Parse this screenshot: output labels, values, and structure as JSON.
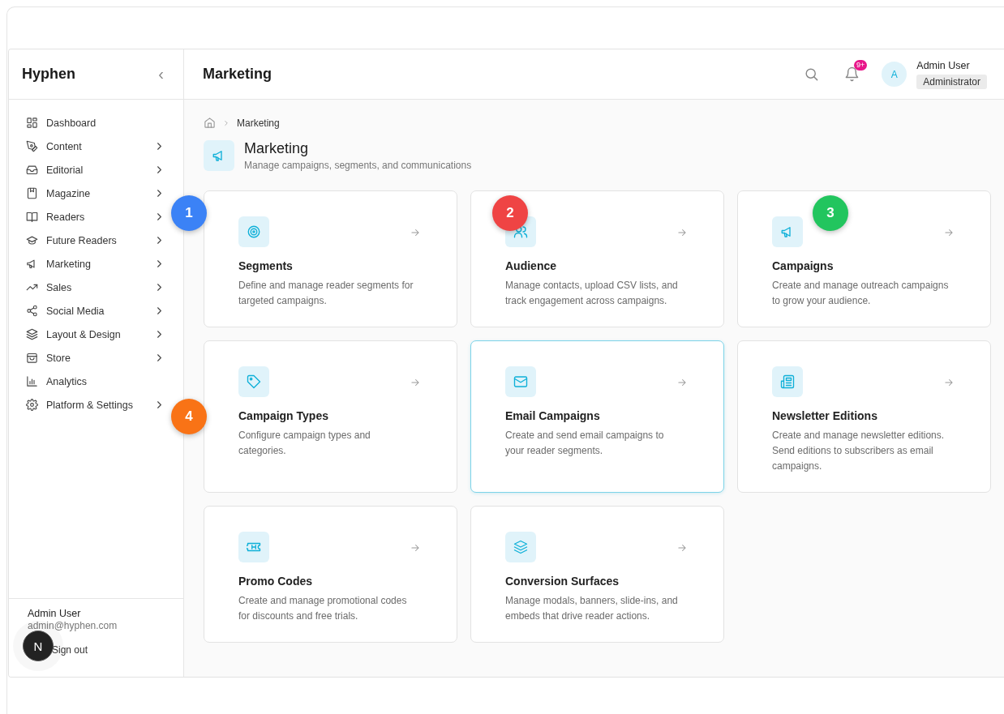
{
  "sidebar": {
    "brand": "Hyphen",
    "collapse_icon": "‹",
    "items": [
      {
        "label": "Dashboard",
        "expandable": false
      },
      {
        "label": "Content",
        "expandable": true
      },
      {
        "label": "Editorial",
        "expandable": true
      },
      {
        "label": "Magazine",
        "expandable": true
      },
      {
        "label": "Readers",
        "expandable": true
      },
      {
        "label": "Future Readers",
        "expandable": true
      },
      {
        "label": "Marketing",
        "expandable": true
      },
      {
        "label": "Sales",
        "expandable": true
      },
      {
        "label": "Social Media",
        "expandable": true
      },
      {
        "label": "Layout & Design",
        "expandable": true
      },
      {
        "label": "Store",
        "expandable": true
      },
      {
        "label": "Analytics",
        "expandable": false
      },
      {
        "label": "Platform & Settings",
        "expandable": true
      }
    ],
    "user": {
      "name": "Admin User",
      "email": "admin@hyphen.com",
      "sign_out": "Sign out"
    }
  },
  "header": {
    "title": "Marketing",
    "notification_badge": "9+",
    "avatar": "A",
    "user_name": "Admin User",
    "role": "Administrator"
  },
  "breadcrumb": [
    "Marketing"
  ],
  "page": {
    "title": "Marketing",
    "subtitle": "Manage campaigns, segments, and communications"
  },
  "cards": [
    {
      "title": "Segments",
      "description": "Define and manage reader segments for targeted campaigns.",
      "selected": false
    },
    {
      "title": "Audience",
      "description": "Manage contacts, upload CSV lists, and track engagement across campaigns.",
      "selected": false
    },
    {
      "title": "Campaigns",
      "description": "Create and manage outreach campaigns to grow your audience.",
      "selected": false
    },
    {
      "title": "Campaign Types",
      "description": "Configure campaign types and categories.",
      "selected": false
    },
    {
      "title": "Email Campaigns",
      "description": "Create and send email campaigns to your reader segments.",
      "selected": true
    },
    {
      "title": "Newsletter Editions",
      "description": "Create and manage newsletter editions. Send editions to subscribers as email campaigns.",
      "selected": false
    },
    {
      "title": "Promo Codes",
      "description": "Create and manage promotional codes for discounts and free trials.",
      "selected": false
    },
    {
      "title": "Conversion Surfaces",
      "description": "Manage modals, banners, slide-ins, and embeds that drive reader actions.",
      "selected": false
    }
  ],
  "annotations": [
    {
      "label": "1",
      "color": "#3b82f6"
    },
    {
      "label": "2",
      "color": "#ef4444"
    },
    {
      "label": "3",
      "color": "#22c55e"
    },
    {
      "label": "4",
      "color": "#f97316"
    }
  ],
  "dev_badge": "N"
}
